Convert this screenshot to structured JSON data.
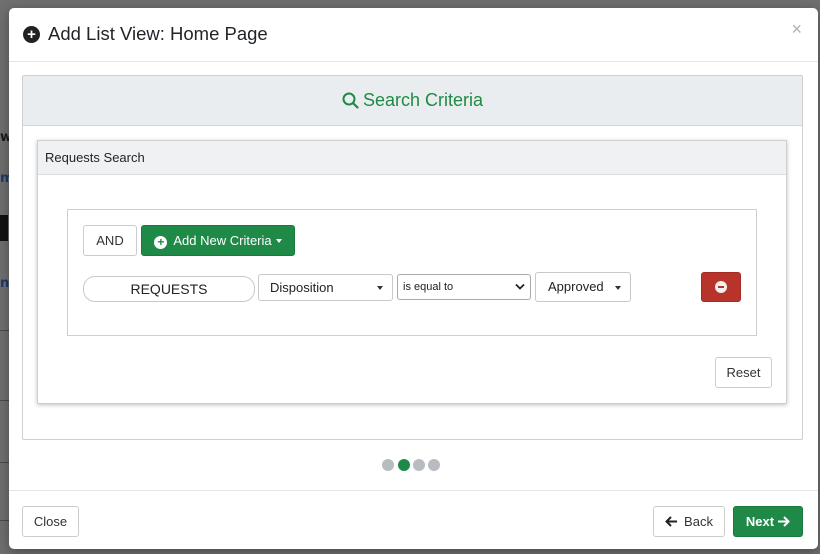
{
  "modal": {
    "title": "Add List View: Home Page",
    "close_glyph": "×",
    "header_icon": "plus-circle-icon"
  },
  "criteria_panel": {
    "title": "Search Criteria",
    "icon": "search-icon",
    "accent_color": "#1e8a44"
  },
  "requests_search": {
    "title": "Requests Search",
    "and_button": "AND",
    "add_button": "Add New Criteria",
    "rule": {
      "entity": "REQUESTS",
      "field": "Disposition",
      "operator": "is equal to",
      "value": "Approved"
    },
    "reset_button": "Reset",
    "remove_color": "#b8342b"
  },
  "wizard": {
    "steps": 4,
    "active_step": 2
  },
  "footer": {
    "close_button": "Close",
    "back_button": "Back",
    "next_button": "Next",
    "back_arrow": "🡐",
    "next_arrow": "🡒"
  }
}
